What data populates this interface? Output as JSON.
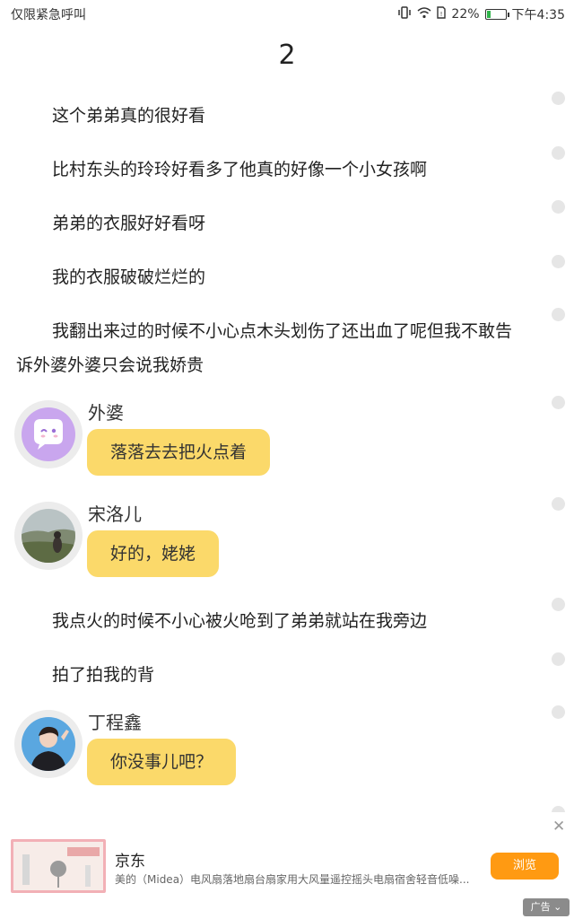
{
  "status_bar": {
    "carrier": "仅限紧急呼叫",
    "battery_pct": "22%",
    "battery_level": 0.22,
    "time": "下午4:35",
    "icons": [
      "vibrate-icon",
      "wifi-icon",
      "sim-icon",
      "battery-icon"
    ]
  },
  "chapter": {
    "number": "2"
  },
  "story": {
    "narrations": [
      "这个弟弟真的很好看",
      "比村东头的玲玲好看多了他真的好像一个小女孩啊",
      "弟弟的衣服好好看呀",
      "我的衣服破破烂烂的",
      "我翻出来过的时候不小心点木头划伤了还出血了呢但我不敢告诉外婆外婆只会说我娇贵"
    ],
    "chats": [
      {
        "speaker": "外婆",
        "text": "落落去去把火点着"
      },
      {
        "speaker": "宋洛儿",
        "text": "好的，姥姥"
      }
    ],
    "narrations_2": [
      "我点火的时候不小心被火呛到了弟弟就站在我旁边",
      "拍了拍我的背"
    ],
    "chat_3": {
      "speaker": "丁程鑫",
      "text": "你没事儿吧？"
    }
  },
  "ad": {
    "brand": "京东",
    "description": "美的（Midea）电风扇落地扇台扇家用大风量遥控摇头电扇宿舍轻音低噪...",
    "button_label": "浏览",
    "close_symbol": "✕",
    "tag_label": "广告"
  },
  "colors": {
    "bubble": "#fbd96a",
    "ad_button": "#ff9a12",
    "battery_fill": "#2fb44a"
  }
}
